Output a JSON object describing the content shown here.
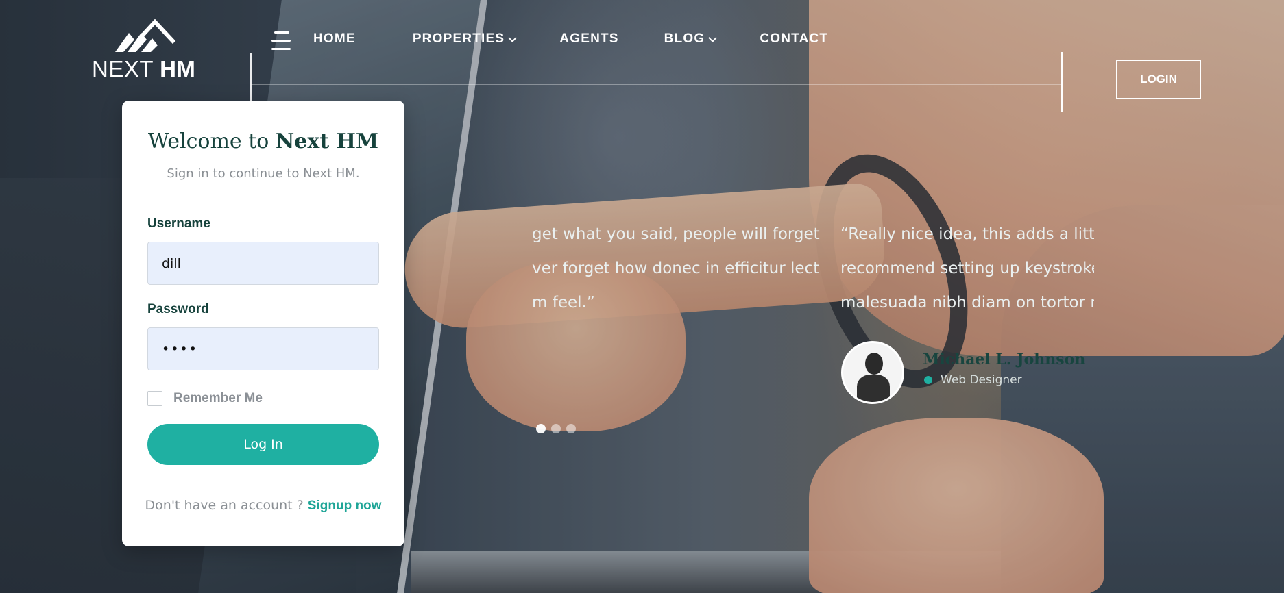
{
  "brand": {
    "name_light": "NEXT",
    "name_bold": "HM"
  },
  "nav": {
    "items": [
      {
        "label": "HOME",
        "dropdown": false
      },
      {
        "label": "PROPERTIES",
        "dropdown": true
      },
      {
        "label": "AGENTS",
        "dropdown": false
      },
      {
        "label": "BLOG",
        "dropdown": true
      },
      {
        "label": "CONTACT",
        "dropdown": false
      }
    ],
    "login_label": "LOGIN"
  },
  "login_card": {
    "title_prefix": "Welcome to",
    "title_brand": "Next HM",
    "subtitle": "Sign in to continue to Next HM.",
    "username_label": "Username",
    "username_value": "dill",
    "password_label": "Password",
    "password_value": "••••",
    "remember_label": "Remember Me",
    "remember_checked": false,
    "submit_label": "Log In",
    "signup_prompt": "Don't have an account ?",
    "signup_link": "Signup now"
  },
  "testimonials": {
    "quote_a": [
      "get what you said, people will forget",
      "ver forget how donec in efficitur lectus,",
      "m feel.”"
    ],
    "quote_b": [
      "“Really nice idea, this adds a little",
      "recommend setting up keystrokes",
      "malesuada nibh diam on tortor ne"
    ],
    "person_name": "Michael L. Johnson",
    "person_role": "Web Designer",
    "slide_count": 3,
    "active_slide": 0
  },
  "colors": {
    "accent": "#1fb0a2",
    "heading": "#16423c",
    "input_bg": "#e8effc"
  }
}
